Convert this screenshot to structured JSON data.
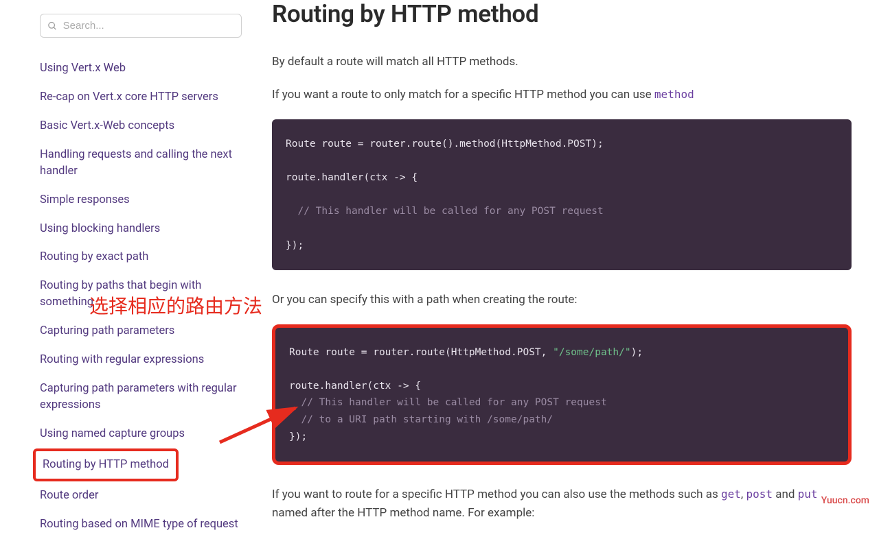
{
  "search": {
    "placeholder": "Search..."
  },
  "sidebar": {
    "items": [
      {
        "label": "Using Vert.x Web"
      },
      {
        "label": "Re-cap on Vert.x core HTTP servers"
      },
      {
        "label": "Basic Vert.x-Web concepts"
      },
      {
        "label": "Handling requests and calling the next handler"
      },
      {
        "label": "Simple responses"
      },
      {
        "label": "Using blocking handlers"
      },
      {
        "label": "Routing by exact path"
      },
      {
        "label": "Routing by paths that begin with something"
      },
      {
        "label": "Capturing path parameters"
      },
      {
        "label": "Routing with regular expressions"
      },
      {
        "label": "Capturing path parameters with regular expressions"
      },
      {
        "label": "Using named capture groups"
      },
      {
        "label": "Routing by HTTP method",
        "highlighted": true
      },
      {
        "label": "Route order"
      },
      {
        "label": "Routing based on MIME type of request"
      }
    ]
  },
  "content": {
    "heading": "Routing by HTTP method",
    "p1": "By default a route will match all HTTP methods.",
    "p2_a": "If you want a route to only match for a specific HTTP method you can use ",
    "p2_link": "method",
    "code1_l1": "Route route = router.route().method(HttpMethod.POST);",
    "code1_l2": "",
    "code1_l3": "route.handler(ctx -> {",
    "code1_l4": "",
    "code1_l5": "  // This handler will be called for any POST request",
    "code1_l6": "",
    "code1_l7": "});",
    "p3": "Or you can specify this with a path when creating the route:",
    "code2_l1a": "Route route = router.route(HttpMethod.POST, ",
    "code2_l1s": "\"/some/path/\"",
    "code2_l1b": ");",
    "code2_l2": "",
    "code2_l3": "route.handler(ctx -> {",
    "code2_l4": "  // This handler will be called for any POST request",
    "code2_l5": "  // to a URI path starting with /some/path/",
    "code2_l6": "});",
    "p4_a": "If you want to route for a specific HTTP method you can also use the methods such as ",
    "p4_get": "get",
    "p4_comma1": ", ",
    "p4_post": "post",
    "p4_and": " and ",
    "p4_put": "put",
    "p4_b": " named after the HTTP method name. For example:"
  },
  "annotation": {
    "text": "选择相应的路由方法"
  },
  "watermark": "Yuucn.com"
}
